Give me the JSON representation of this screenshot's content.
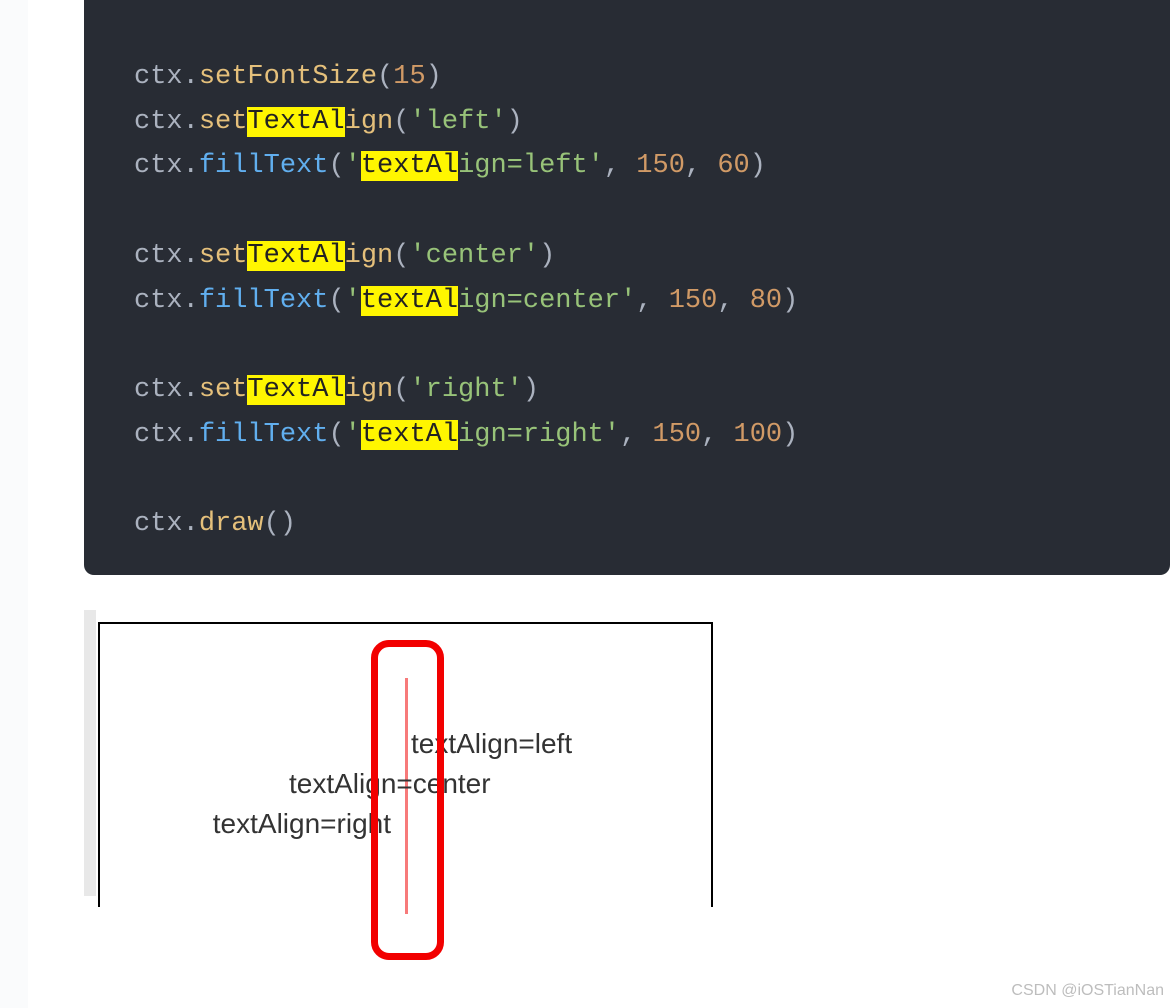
{
  "code": {
    "l1": {
      "obj": "ctx",
      "sep": ".",
      "method": "setFontSize",
      "open": "(",
      "arg": "15",
      "close": ")"
    },
    "l2": {
      "obj": "ctx",
      "sep": ".",
      "m1": "set",
      "m_hl": "TextAl",
      "m2": "ign",
      "open": "(",
      "arg": "'left'",
      "close": ")"
    },
    "l3": {
      "obj": "ctx",
      "sep": ".",
      "method": "fillText",
      "open": "(",
      "q1": "'",
      "a_hl": "textAl",
      "a2": "ign=left'",
      "comma1": ", ",
      "n1": "150",
      "comma2": ", ",
      "n2": "60",
      "close": ")"
    },
    "l4": {
      "obj": "ctx",
      "sep": ".",
      "m1": "set",
      "m_hl": "TextAl",
      "m2": "ign",
      "open": "(",
      "arg": "'center'",
      "close": ")"
    },
    "l5": {
      "obj": "ctx",
      "sep": ".",
      "method": "fillText",
      "open": "(",
      "q1": "'",
      "a_hl": "textAl",
      "a2": "ign=center'",
      "comma1": ", ",
      "n1": "150",
      "comma2": ", ",
      "n2": "80",
      "close": ")"
    },
    "l6": {
      "obj": "ctx",
      "sep": ".",
      "m1": "set",
      "m_hl": "TextAl",
      "m2": "ign",
      "open": "(",
      "arg": "'right'",
      "close": ")"
    },
    "l7": {
      "obj": "ctx",
      "sep": ".",
      "method": "fillText",
      "open": "(",
      "q1": "'",
      "a_hl": "textAl",
      "a2": "ign=right'",
      "comma1": ", ",
      "n1": "150",
      "comma2": ", ",
      "n2": "100",
      "close": ")"
    },
    "l8": {
      "obj": "ctx",
      "sep": ".",
      "method": "draw",
      "open": "(",
      "close": ")"
    }
  },
  "diagram": {
    "left": "textAlign=left",
    "center": "textAlign=center",
    "right": "textAlign=right"
  },
  "watermark": "CSDN @iOSTianNan"
}
